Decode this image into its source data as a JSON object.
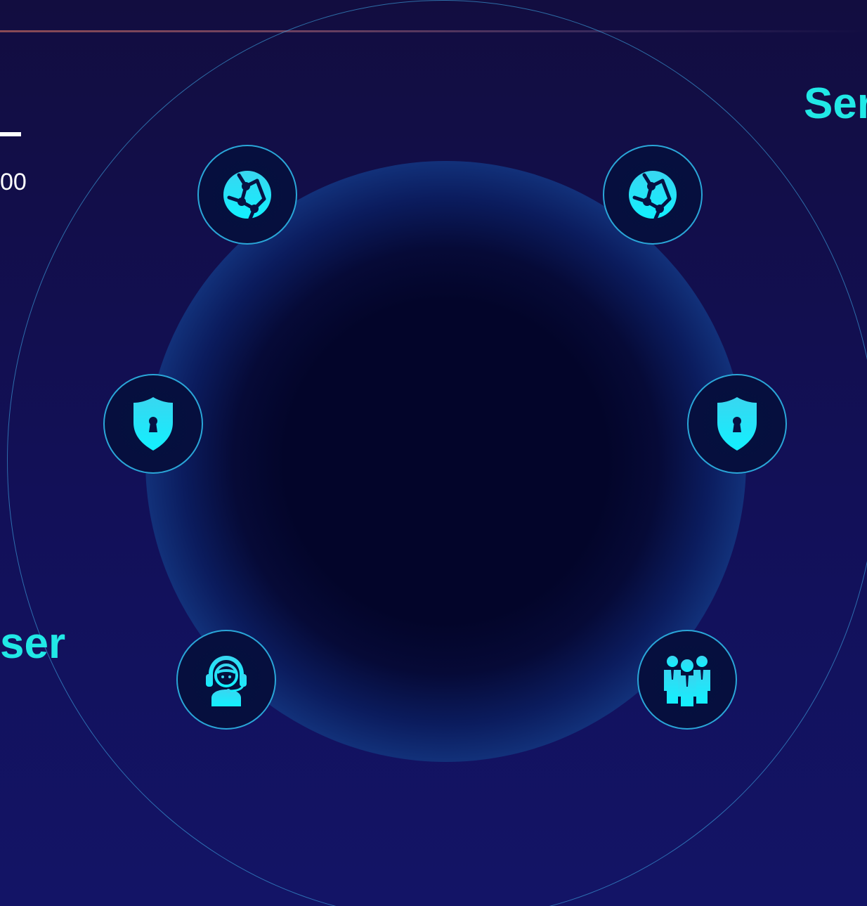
{
  "header": {
    "title": "",
    "rule_color": "#8a4a55"
  },
  "left_panel": {
    "value_text": "00",
    "label_text": "ser"
  },
  "right_panel": {
    "label_text": "Ser"
  },
  "colors": {
    "accent_cyan": "#21e8e6",
    "node_border": "#2aa6d8",
    "background": "#120d40"
  },
  "nodes": [
    {
      "icon": "globe-network-icon"
    },
    {
      "icon": "globe-network-icon"
    },
    {
      "icon": "shield-lock-icon"
    },
    {
      "icon": "shield-lock-icon"
    },
    {
      "icon": "customer-support-icon"
    },
    {
      "icon": "team-group-icon"
    }
  ]
}
